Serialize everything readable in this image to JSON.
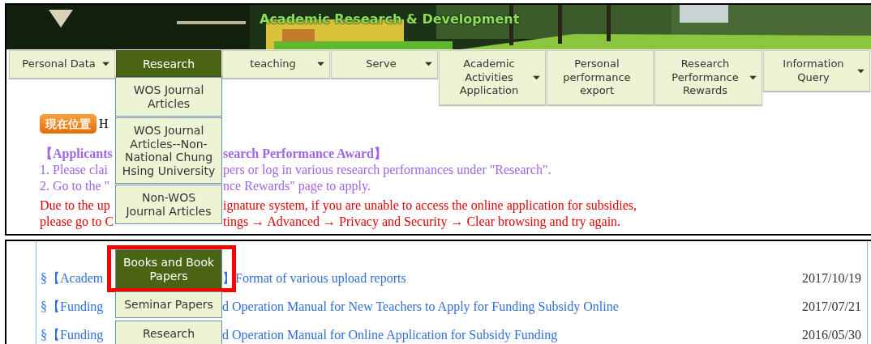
{
  "banner": {
    "title": "Academic Research & Development"
  },
  "nav": [
    {
      "label": "Personal Data",
      "has_dropdown": true,
      "selected": false
    },
    {
      "label": "Research",
      "has_dropdown": false,
      "selected": true
    },
    {
      "label": "teaching",
      "has_dropdown": true,
      "selected": false
    },
    {
      "label": "Serve",
      "has_dropdown": true,
      "selected": false
    },
    {
      "label": "Academic Activities Application",
      "has_dropdown": true,
      "selected": false
    },
    {
      "label": "Personal performance export",
      "has_dropdown": false,
      "selected": false
    },
    {
      "label": "Research Performance Rewards",
      "has_dropdown": true,
      "selected": false
    },
    {
      "label": "Information Query",
      "has_dropdown": true,
      "selected": false
    }
  ],
  "top_panel": {
    "dropdown": [
      {
        "label": "WOS Journal Articles",
        "selected": false
      },
      {
        "label": "WOS Journal Articles--Non-National Chung Hsing University",
        "selected": false
      },
      {
        "label": "Non-WOS Journal Articles",
        "selected": false
      }
    ],
    "breadcrumb": {
      "badge": "現在位置",
      "text": "H"
    },
    "lines": [
      {
        "kind": "heading",
        "left": "【Applicants",
        "right": "search Performance Award】"
      },
      {
        "kind": "step",
        "left": "1. Please clai",
        "right": "pers or log in various research performances under \"Research\"."
      },
      {
        "kind": "step",
        "left": "2. Go to the \"",
        "right": "nce Rewards\" page to apply."
      },
      {
        "kind": "warning",
        "left": "Due to the up",
        "right": "ignature system, if you are unable to access the online application for subsidies,"
      },
      {
        "kind": "warning",
        "left": "please go to C",
        "right": "tings → Advanced → Privacy and Security → Clear browsing and try again."
      }
    ]
  },
  "bottom_panel": {
    "dropdown": [
      {
        "label": "Books and Book Papers",
        "selected": true,
        "annotated": true
      },
      {
        "label": "Seminar Papers",
        "selected": false,
        "annotated": false
      },
      {
        "label": "Research",
        "selected": false,
        "annotated": false
      }
    ],
    "announcements": [
      {
        "left": "§【Academ",
        "right": "】Format of various upload reports",
        "date": "2017/10/19"
      },
      {
        "left": "§【Funding",
        "right": "d Operation Manual for New Teachers to Apply for Funding Subsidy Online",
        "date": "2017/07/21"
      },
      {
        "left": "§【Funding",
        "right": "d Operation Manual for Online Application for Subsidy Funding",
        "date": "2016/05/30"
      }
    ]
  }
}
